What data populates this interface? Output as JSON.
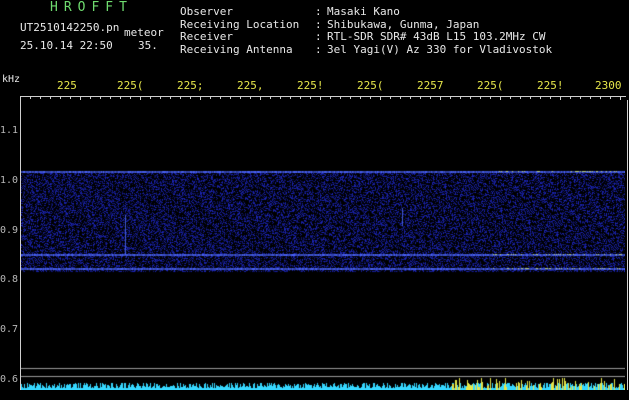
{
  "header": {
    "title": "HROFFT",
    "filename": "UT2510142250.pn",
    "meteor_label": "meteor",
    "datetime": "25.10.14 22:50",
    "count": "35."
  },
  "info": [
    {
      "label": "Observer",
      "sep": ":",
      "value": "Masaki Kano"
    },
    {
      "label": "Receiving Location",
      "sep": ":",
      "value": "Shibukawa, Gunma, Japan"
    },
    {
      "label": "Receiver",
      "sep": ":",
      "value": "RTL-SDR SDR# 43dB L15 103.2MHz CW"
    },
    {
      "label": "Receiving Antenna",
      "sep": ":",
      "value": "3el Yagi(V) Az 330 for Vladivostok"
    }
  ],
  "axis": {
    "y_unit": "kHz",
    "y_ticks": [
      "1.1",
      "1.0",
      "0.9",
      "0.8",
      "0.7",
      "0.6"
    ],
    "x_ticks": [
      "225",
      "225(",
      "225;",
      "225,",
      "225!",
      "225(",
      "2257",
      "225(",
      "225!",
      "2300"
    ]
  },
  "colors": {
    "text_green": "#6fdc6f",
    "text_white": "#e8e8e8",
    "tick_yellow": "#e6e64a",
    "signal_blue": "#2a3cff",
    "noise_bar_cyan": "#36d7ff"
  }
}
